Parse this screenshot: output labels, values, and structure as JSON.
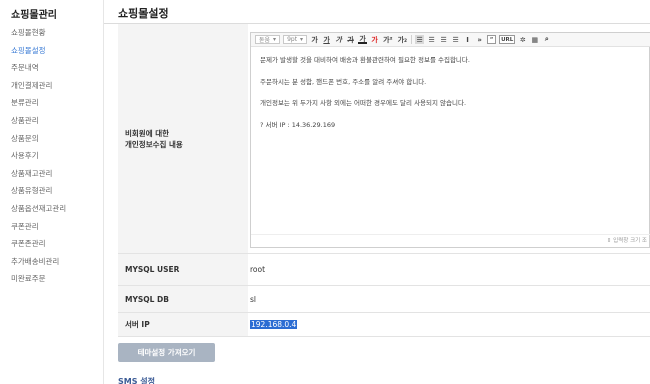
{
  "sidebar": {
    "title": "쇼핑몰관리",
    "items": [
      {
        "label": "쇼핑몰현황"
      },
      {
        "label": "쇼핑몰설정"
      },
      {
        "label": "주문내역"
      },
      {
        "label": "개인결제관리"
      },
      {
        "label": "분류관리"
      },
      {
        "label": "상품관리"
      },
      {
        "label": "상품문의"
      },
      {
        "label": "사용후기"
      },
      {
        "label": "상품재고관리"
      },
      {
        "label": "상품유형관리"
      },
      {
        "label": "상품옵션재고관리"
      },
      {
        "label": "쿠폰관리"
      },
      {
        "label": "쿠폰존관리"
      },
      {
        "label": "추가배송비관리"
      },
      {
        "label": "미완료주문"
      }
    ]
  },
  "page": {
    "title": "쇼핑몰설정"
  },
  "privacy": {
    "label": "비회원에 대한\n개인정보수집 내용",
    "toolbar": {
      "font_select": "돋움",
      "size_select": "9pt",
      "more": "»",
      "quote": "“",
      "url": "URL"
    },
    "content_lines": [
      "문제가 발생할 것을 대비하여 배송과 환불관련하여 필요한 정보를 수집합니다.",
      "주문하시는 분 성함, 핸드폰 번호, 주소를 알려 주셔야 합니다.",
      "개인정보는 위 두가지 사항 외에는 어떠한 경우에도 달리 사용되지 않습니다.",
      "? 서버 IP : 14.36.29.169"
    ],
    "resize_label": "⇕ 입력창 크기 조"
  },
  "mysql_user": {
    "label": "MYSQL USER",
    "value": "root"
  },
  "mysql_db": {
    "label": "MYSQL DB",
    "value": "sl"
  },
  "server_ip": {
    "label": "서버 IP",
    "value": "192.168.0.4"
  },
  "buttons": {
    "import_theme": "테마설정 가져오기"
  },
  "sections": {
    "sms_title": "SMS 설정"
  },
  "colors": {
    "accent": "#3a7bd5",
    "selection": "#2c6dd3",
    "button": "#a9b4c2"
  }
}
